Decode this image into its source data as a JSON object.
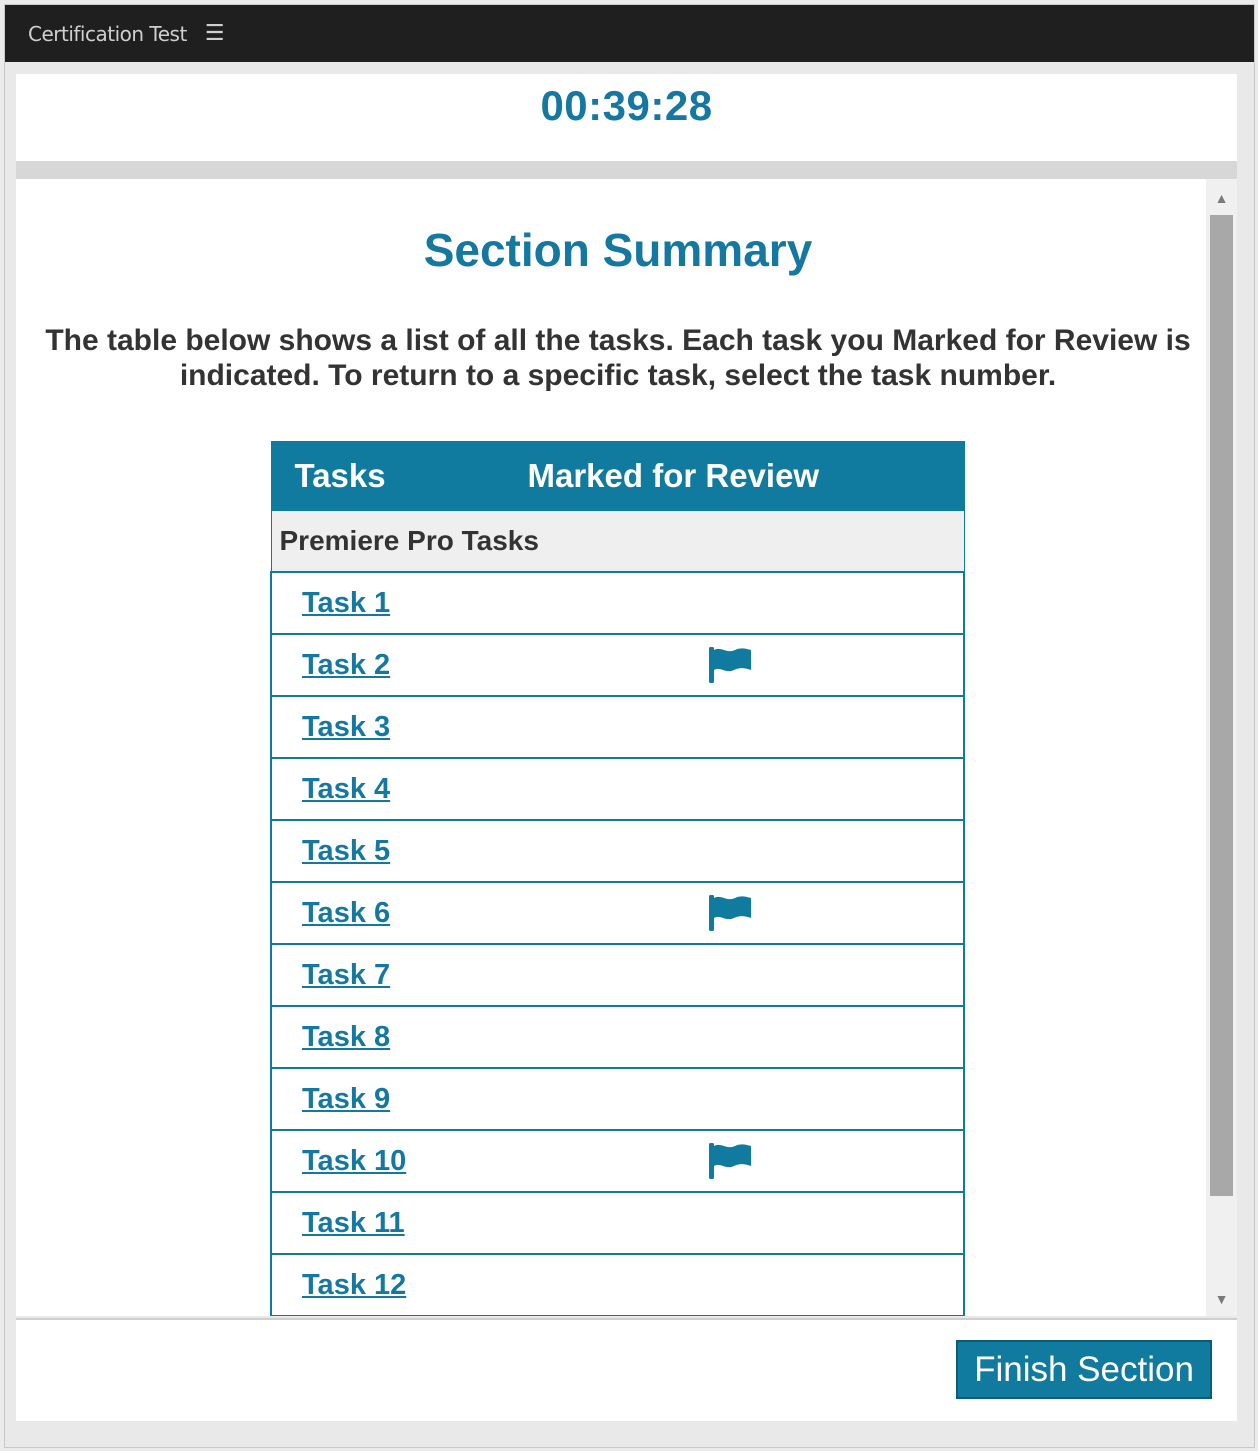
{
  "window": {
    "title": "Certification Test",
    "menu_icon": "hamburger-menu-icon"
  },
  "timer": "00:39:28",
  "summary": {
    "heading": "Section Summary",
    "intro": "The table below shows a list of all the tasks. Each task you Marked for Review is indicated. To return to a specific task, select the task number."
  },
  "table": {
    "col_tasks": "Tasks",
    "col_review": "Marked for Review",
    "group": "Premiere Pro Tasks",
    "rows": [
      {
        "label": "Task 1",
        "marked": false
      },
      {
        "label": "Task 2",
        "marked": true
      },
      {
        "label": "Task 3",
        "marked": false
      },
      {
        "label": "Task 4",
        "marked": false
      },
      {
        "label": "Task 5",
        "marked": false
      },
      {
        "label": "Task 6",
        "marked": true
      },
      {
        "label": "Task 7",
        "marked": false
      },
      {
        "label": "Task 8",
        "marked": false
      },
      {
        "label": "Task 9",
        "marked": false
      },
      {
        "label": "Task 10",
        "marked": true
      },
      {
        "label": "Task 11",
        "marked": false
      },
      {
        "label": "Task 12",
        "marked": false
      }
    ]
  },
  "footer": {
    "finish_label": "Finish Section"
  },
  "colors": {
    "accent": "#117a9f",
    "titlebar": "#1f1f1f",
    "text": "#333333"
  }
}
